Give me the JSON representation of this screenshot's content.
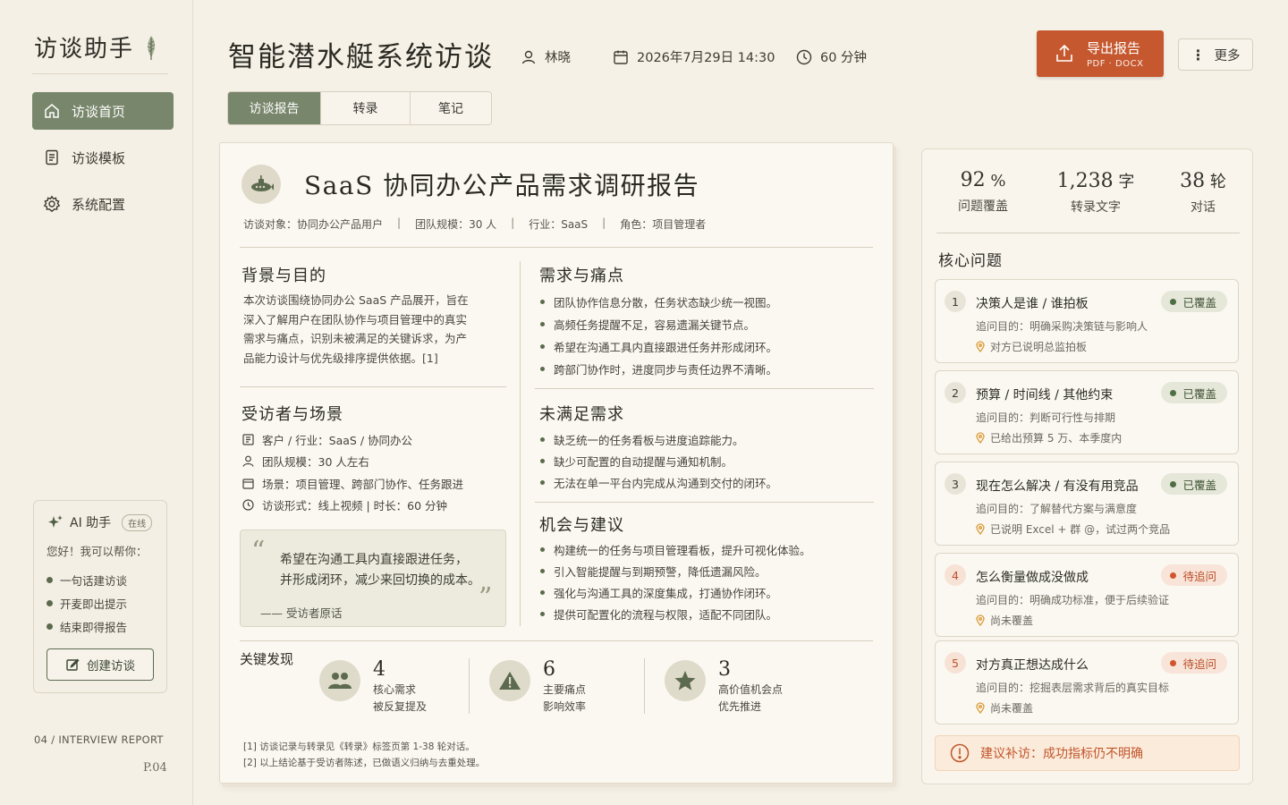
{
  "sidebar": {
    "logo": "访谈助手",
    "nav": [
      {
        "label": "访谈首页",
        "icon": "home-icon",
        "active": true
      },
      {
        "label": "访谈模板",
        "icon": "document-icon",
        "active": false
      },
      {
        "label": "系统配置",
        "icon": "gear-icon",
        "active": false
      }
    ],
    "ai": {
      "title": "AI 助手",
      "status": "在线",
      "hello": "您好！我可以帮你：",
      "items": [
        "一句话建访谈",
        "开麦即出提示",
        "结束即得报告"
      ],
      "create_label": "创建访谈"
    },
    "footer_code": "04 / INTERVIEW REPORT",
    "footer_page": "P.04"
  },
  "header": {
    "title": "智能潜水艇系统访谈",
    "interviewer": "林晓",
    "datetime": "2026年7月29日  14:30",
    "duration": "60 分钟",
    "export_label": "导出报告",
    "export_formats": "PDF · DOCX",
    "more_label": "更多"
  },
  "tabs": [
    {
      "label": "访谈报告",
      "active": true
    },
    {
      "label": "转录",
      "active": false
    },
    {
      "label": "笔记",
      "active": false
    }
  ],
  "report": {
    "title": "SaaS 协同办公产品需求调研报告",
    "subtitle": {
      "target": "访谈对象：协同办公产品用户",
      "team": "团队规模：30 人",
      "industry": "行业：SaaS",
      "role": "角色：项目管理者"
    },
    "background": {
      "heading": "背景与目的",
      "lines": [
        "本次访谈围绕协同办公 SaaS 产品展开，旨在",
        "深入了解用户在团队协作与项目管理中的真实",
        "需求与痛点，识别未被满足的关键诉求，为产",
        "品能力设计与优先级排序提供依据。[1]"
      ]
    },
    "interviewee": {
      "heading": "受访者与场景",
      "items": [
        {
          "icon": "building-icon",
          "text": "客户 / 行业：SaaS / 协同办公"
        },
        {
          "icon": "person-icon",
          "text": "团队规模：30 人左右"
        },
        {
          "icon": "calendar-icon",
          "text": "场景：项目管理、跨部门协作、任务跟进"
        },
        {
          "icon": "clock-icon",
          "text": "访谈形式：线上视频  |  时长：60 分钟"
        }
      ]
    },
    "quote": {
      "line1": "希望在沟通工具内直接跟进任务，",
      "line2": "并形成闭环，减少来回切换的成本。",
      "by": "——  受访者原话"
    },
    "needs": {
      "heading": "需求与痛点",
      "items": [
        "团队协作信息分散，任务状态缺少统一视图。",
        "高频任务提醒不足，容易遗漏关键节点。",
        "希望在沟通工具内直接跟进任务并形成闭环。",
        "跨部门协作时，进度同步与责任边界不清晰。"
      ]
    },
    "unmet": {
      "heading": "未满足需求",
      "items": [
        "缺乏统一的任务看板与进度追踪能力。",
        "缺少可配置的自动提醒与通知机制。",
        "无法在单一平台内完成从沟通到交付的闭环。"
      ]
    },
    "opps": {
      "heading": "机会与建议",
      "items": [
        "构建统一的任务与项目管理看板，提升可视化体验。",
        "引入智能提醒与到期预警，降低遗漏风险。",
        "强化与沟通工具的深度集成，打通协作闭环。",
        "提供可配置化的流程与权限，适配不同团队。"
      ]
    },
    "key_findings": {
      "heading": "关键发现",
      "items": [
        {
          "num": "4",
          "l1": "核心需求",
          "l2": "被反复提及",
          "icon": "people-icon"
        },
        {
          "num": "6",
          "l1": "主要痛点",
          "l2": "影响效率",
          "icon": "warning-icon"
        },
        {
          "num": "3",
          "l1": "高价值机会点",
          "l2": "优先推进",
          "icon": "star-icon"
        }
      ]
    },
    "notes": [
      "[1] 访谈记录与转录见《转录》标签页第 1-38 轮对话。",
      "[2] 以上结论基于受访者陈述，已做语义归纳与去重处理。"
    ]
  },
  "stats": [
    {
      "num": "92",
      "unit": "%",
      "label": "问题覆盖"
    },
    {
      "num": "1,238",
      "unit": "字",
      "label": "转录文字"
    },
    {
      "num": "38",
      "unit": "轮",
      "label": "对话"
    }
  ],
  "core": {
    "heading": "核心问题",
    "questions": [
      {
        "n": "1",
        "title": "决策人是谁 / 谁拍板",
        "status": "已覆盖",
        "covered": true,
        "goal": "追问目的：明确采购决策链与影响人",
        "note": "对方已说明总监拍板"
      },
      {
        "n": "2",
        "title": "预算 / 时间线 / 其他约束",
        "status": "已覆盖",
        "covered": true,
        "goal": "追问目的：判断可行性与排期",
        "note": "已给出预算 5 万、本季度内"
      },
      {
        "n": "3",
        "title": "现在怎么解决 / 有没有用竞品",
        "status": "已覆盖",
        "covered": true,
        "goal": "追问目的：了解替代方案与满意度",
        "note": "已说明 Excel + 群 @，试过两个竞品"
      },
      {
        "n": "4",
        "title": "怎么衡量做成没做成",
        "status": "待追问",
        "covered": false,
        "goal": "追问目的：明确成功标准，便于后续验证",
        "note": "尚未覆盖"
      },
      {
        "n": "5",
        "title": "对方真正想达成什么",
        "status": "待追问",
        "covered": false,
        "goal": "追问目的：挖掘表层需求背后的真实目标",
        "note": "尚未覆盖"
      }
    ],
    "suggestion": "建议补访：成功指标仍不明确"
  },
  "colors": {
    "accent_green": "#78866b",
    "accent_orange": "#c5582f",
    "background": "#f6f1e7"
  }
}
